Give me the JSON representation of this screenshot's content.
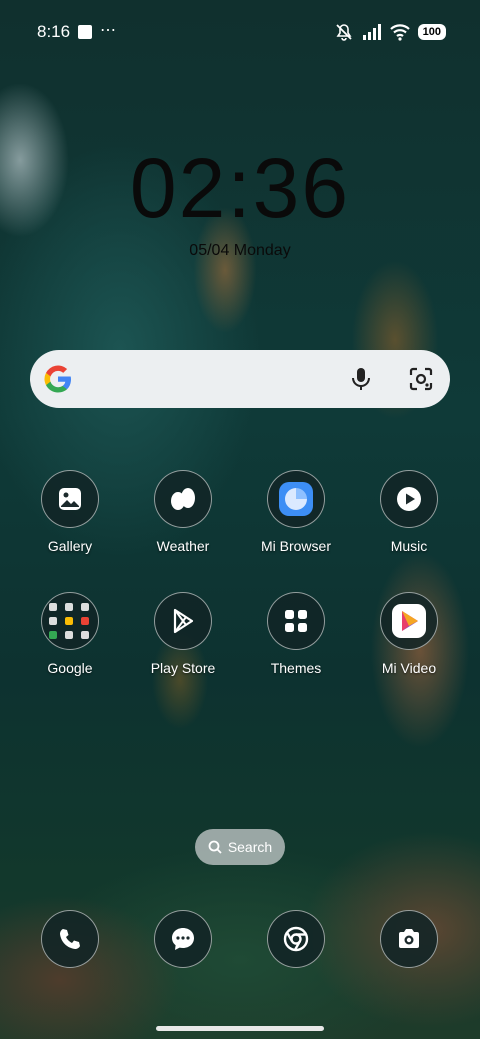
{
  "status_bar": {
    "time": "8:16",
    "more": "⋯",
    "battery": "100",
    "icons": [
      "mute-icon",
      "signal-icon",
      "wifi-icon",
      "battery-icon"
    ]
  },
  "clock": {
    "time": "02:36",
    "date": "05/04 Monday"
  },
  "search_bar": {
    "icons": [
      "google-logo",
      "mic-icon",
      "lens-icon"
    ]
  },
  "apps": [
    {
      "label": "Gallery",
      "icon": "gallery-icon"
    },
    {
      "label": "Weather",
      "icon": "weather-icon"
    },
    {
      "label": "Mi Browser",
      "icon": "mi-browser-icon"
    },
    {
      "label": "Music",
      "icon": "music-icon"
    },
    {
      "label": "Google",
      "icon": "google-folder-icon"
    },
    {
      "label": "Play Store",
      "icon": "play-store-icon"
    },
    {
      "label": "Themes",
      "icon": "themes-icon"
    },
    {
      "label": "Mi Video",
      "icon": "mi-video-icon"
    }
  ],
  "search_pill": {
    "label": "Search"
  },
  "dock": [
    "phone-icon",
    "messages-icon",
    "chrome-icon",
    "camera-icon"
  ]
}
